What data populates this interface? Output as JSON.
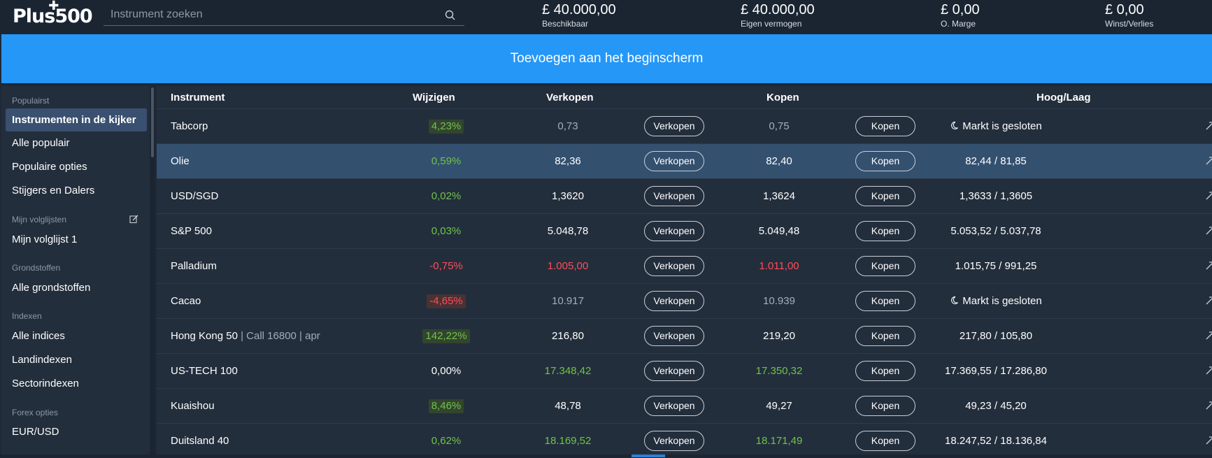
{
  "header": {
    "logo": "Plus500",
    "search_placeholder": "Instrument zoeken",
    "stats": [
      {
        "value": "£ 40.000,00",
        "label": "Beschikbaar"
      },
      {
        "value": "£ 40.000,00",
        "label": "Eigen vermogen"
      },
      {
        "value": "£ 0,00",
        "label": "O. Marge"
      },
      {
        "value": "£ 0,00",
        "label": "Winst/Verlies"
      }
    ]
  },
  "banner": {
    "text": "Toevoegen aan het beginscherm"
  },
  "sidebar": {
    "sections": [
      {
        "title": "Populairst",
        "items": [
          "Instrumenten in de kijker",
          "Alle populair",
          "Populaire opties",
          "Stijgers en Dalers"
        ]
      },
      {
        "title": "Mijn volglijsten",
        "items": [
          "Mijn volglijst 1"
        ]
      },
      {
        "title": "Grondstoffen",
        "items": [
          "Alle grondstoffen"
        ]
      },
      {
        "title": "Indexen",
        "items": [
          "Alle indices",
          "Landindexen",
          "Sectorindexen"
        ]
      },
      {
        "title": "Forex opties",
        "items": [
          "EUR/USD"
        ]
      }
    ],
    "active_item": "Instrumenten in de kijker"
  },
  "table": {
    "columns": {
      "instrument": "Instrument",
      "change": "Wijzigen",
      "sell": "Verkopen",
      "buy": "Kopen",
      "highlow": "Hoog/Laag"
    },
    "sell_button": "Verkopen",
    "buy_button": "Kopen",
    "market_closed": "Markt is gesloten",
    "rows": [
      {
        "name": "Tabcorp",
        "sub": "",
        "change": "4,23%",
        "sell": "0,73",
        "buy": "0,75",
        "highlow": "Markt is gesloten"
      },
      {
        "name": "Olie",
        "sub": "",
        "change": "0,59%",
        "sell": "82,36",
        "buy": "82,40",
        "highlow": "82,44 / 81,85"
      },
      {
        "name": "USD/SGD",
        "sub": "",
        "change": "0,02%",
        "sell": "1,3620",
        "buy": "1,3624",
        "highlow": "1,3633 / 1,3605"
      },
      {
        "name": "S&P 500",
        "sub": "",
        "change": "0,03%",
        "sell": "5.048,78",
        "buy": "5.049,48",
        "highlow": "5.053,52 / 5.037,78"
      },
      {
        "name": "Palladium",
        "sub": "",
        "change": "-0,75%",
        "sell": "1.005,00",
        "buy": "1.011,00",
        "highlow": "1.015,75 / 991,25"
      },
      {
        "name": "Cacao",
        "sub": "",
        "change": "-4,65%",
        "sell": "10.917",
        "buy": "10.939",
        "highlow": "Markt is gesloten"
      },
      {
        "name": "Hong Kong 50",
        "sub": " | Call 16800 | apr",
        "change": "142,22%",
        "sell": "216,80",
        "buy": "219,20",
        "highlow": "217,80 / 105,80"
      },
      {
        "name": "US-TECH 100",
        "sub": "",
        "change": "0,00%",
        "sell": "17.348,42",
        "buy": "17.350,32",
        "highlow": "17.369,55 / 17.286,80"
      },
      {
        "name": "Kuaishou",
        "sub": "",
        "change": "8,46%",
        "sell": "48,78",
        "buy": "49,27",
        "highlow": "49,23 / 45,20"
      },
      {
        "name": "Duitsland 40",
        "sub": "",
        "change": "0,62%",
        "sell": "18.169,52",
        "buy": "18.171,49",
        "highlow": "18.247,52 / 18.136,84"
      }
    ]
  },
  "colors": {
    "accent": "#2597f7",
    "positive": "#6fc34a",
    "negative": "#ff4d57",
    "highlight_row": "#33506f"
  }
}
